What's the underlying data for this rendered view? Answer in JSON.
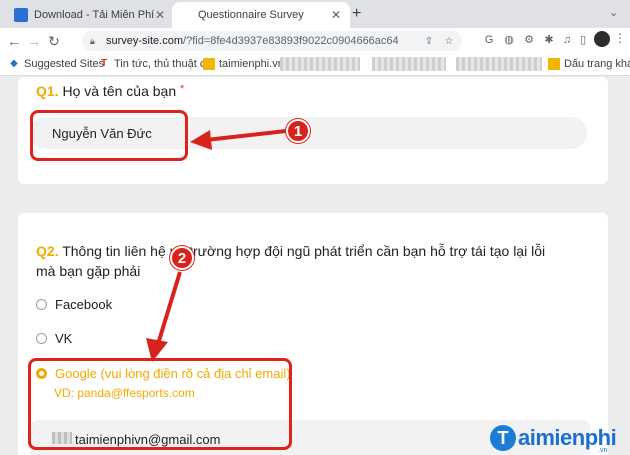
{
  "browser": {
    "tabs": [
      {
        "title": "Download - Tải Miễn Phí VN - Ph",
        "active": false
      },
      {
        "title": "Questionnaire Survey",
        "active": true
      }
    ],
    "new_tab": "+",
    "address": {
      "host": "survey-site.com",
      "path": "/?fid=8fe4d3937e83893f9022c0904666ac64"
    },
    "bookmarks": [
      {
        "label": "Suggested Sites"
      },
      {
        "label": "Tin tức, thủ thuật c..."
      },
      {
        "label": "taimienphi.vn"
      },
      {
        "label": "Dấu trang khá"
      }
    ]
  },
  "form": {
    "q1": {
      "number": "Q1.",
      "text": "Họ và tên của bạn",
      "required_mark": "*",
      "answer": "Nguyễn Văn Đức"
    },
    "q2": {
      "number": "Q2.",
      "text_line1": "Thông tin liên hệ      ng trường hợp đội ngũ phát triển cần bạn hỗ trợ tái tạo lại lỗi",
      "text_line2": "mà bạn gặp phải",
      "options": [
        {
          "label": "Facebook",
          "selected": false
        },
        {
          "label": "VK",
          "selected": false
        },
        {
          "label": "Google (vui lòng điền rõ cả địa chỉ email)",
          "selected": true
        }
      ],
      "hint": "VD: panda@ffesports.com",
      "answer": "taimienphivn@gmail.com"
    }
  },
  "annotations": {
    "badge1": "1",
    "badge2": "2",
    "color": "#d8231d"
  },
  "watermark": {
    "logo": "T",
    "text": "aimienphi",
    "sub": ".vn"
  },
  "colors": {
    "accent": "#f2a900",
    "annotation": "#e0211c"
  }
}
